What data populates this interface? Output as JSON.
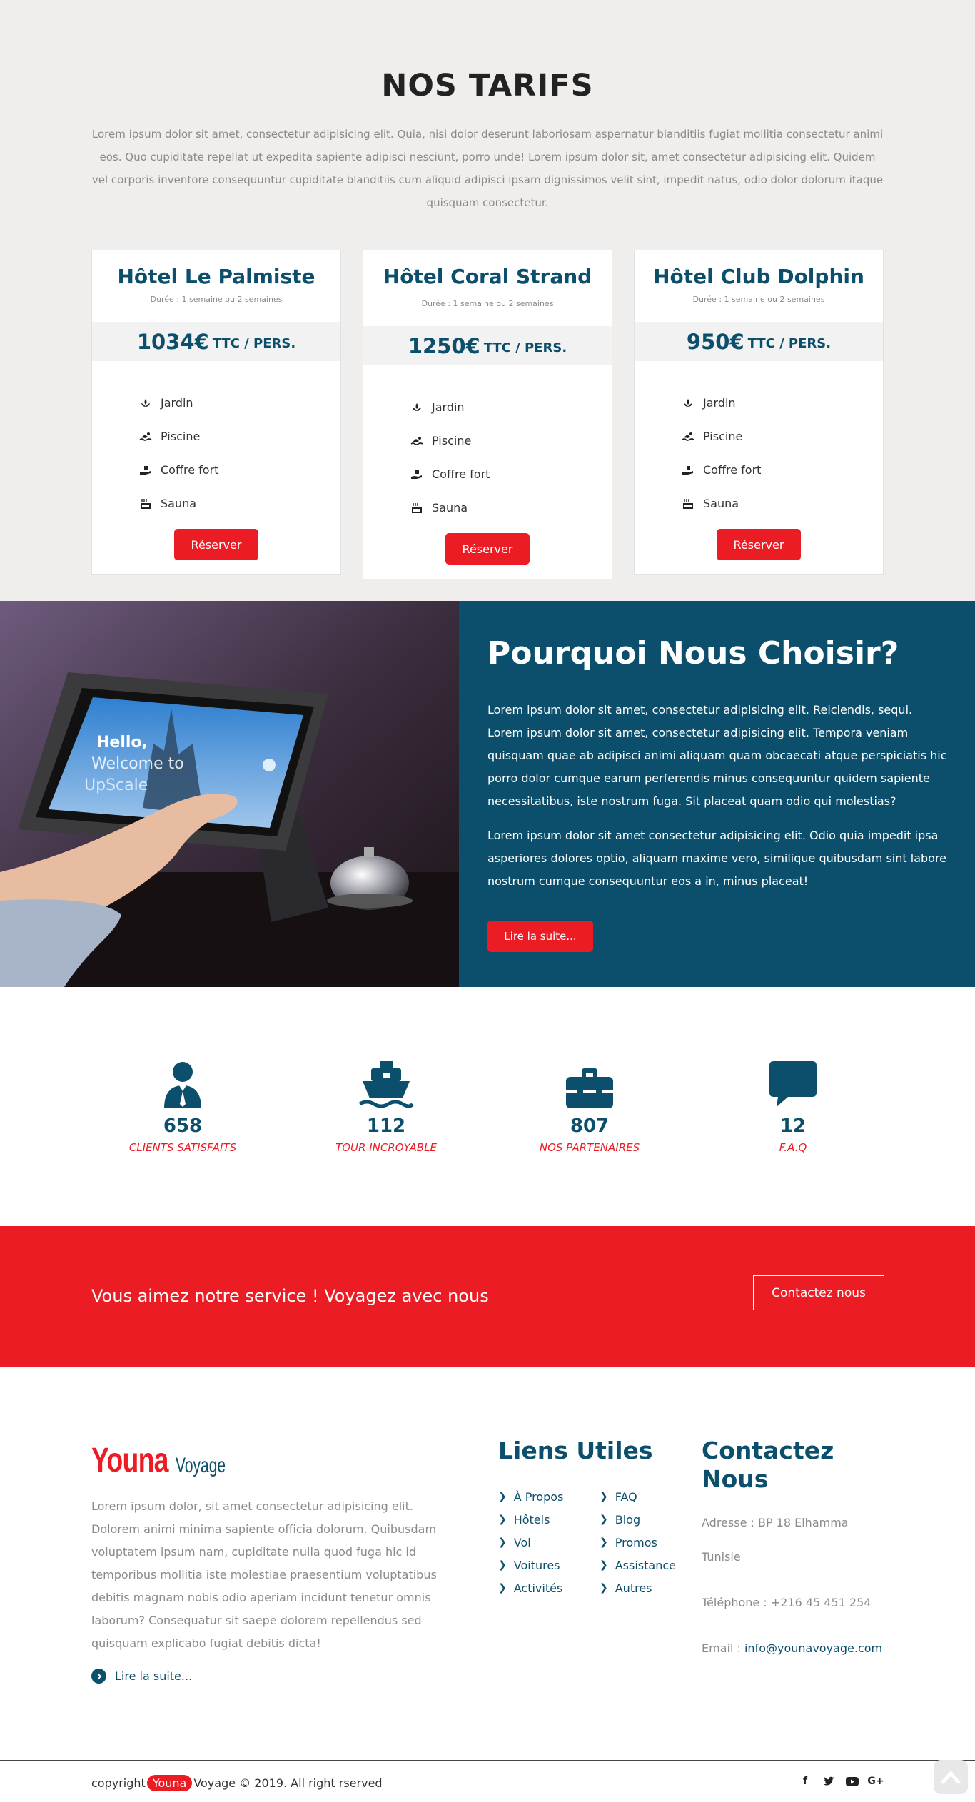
{
  "pricing": {
    "title": "NOS TARIFS",
    "intro": "Lorem ipsum dolor sit amet, consectetur adipisicing elit. Quia, nisi dolor deserunt laboriosam aspernatur blanditiis fugiat mollitia consectetur animi eos. Quo cupiditate repellat ut expedita sapiente adipisci nesciunt, porro unde! Lorem ipsum dolor sit, amet consectetur adipisicing elit. Quidem vel corporis inventore consequuntur cupiditate blanditiis cum aliquid adipisci ipsam dignissimos velit sint, impedit natus, odio dolor dolorum itaque quisquam consectetur.",
    "cards": [
      {
        "name": "Hôtel Le Palmiste",
        "duration": "Durée : 1 semaine ou 2 semaines",
        "price": "1034€",
        "unit": "TTC / PERS.",
        "features": [
          {
            "label": "Jardin",
            "icon": "spa-icon"
          },
          {
            "label": "Piscine",
            "icon": "swimmer-icon"
          },
          {
            "label": "Coffre fort",
            "icon": "hand-holding-icon"
          },
          {
            "label": "Sauna",
            "icon": "hot-tub-icon"
          }
        ],
        "button": "Réserver"
      },
      {
        "name": "Hôtel Coral Strand",
        "duration": "Durée : 1 semaine ou 2 semaines",
        "price": "1250€",
        "unit": "TTC / PERS.",
        "features": [
          {
            "label": "Jardin",
            "icon": "spa-icon"
          },
          {
            "label": "Piscine",
            "icon": "swimmer-icon"
          },
          {
            "label": "Coffre fort",
            "icon": "hand-holding-icon"
          },
          {
            "label": "Sauna",
            "icon": "hot-tub-icon"
          }
        ],
        "button": "Réserver"
      },
      {
        "name": "Hôtel Club Dolphin",
        "duration": "Durée : 1 semaine ou 2 semaines",
        "price": "950€",
        "unit": "TTC / PERS.",
        "features": [
          {
            "label": "Jardin",
            "icon": "spa-icon"
          },
          {
            "label": "Piscine",
            "icon": "swimmer-icon"
          },
          {
            "label": "Coffre fort",
            "icon": "hand-holding-icon"
          },
          {
            "label": "Sauna",
            "icon": "hot-tub-icon"
          }
        ],
        "button": "Réserver"
      }
    ]
  },
  "why": {
    "title": "Pourquoi Nous Choisir?",
    "paragraph1": "Lorem ipsum dolor sit amet, consectetur adipisicing elit. Reiciendis, sequi. Lorem ipsum dolor sit amet, consectetur adipisicing elit. Tempora veniam quisquam quae ab adipisci animi aliquam quam obcaecati atque perspiciatis hic porro dolor cumque earum perferendis minus consequuntur quidem sapiente necessitatibus, iste nostrum fuga. Sit placeat quam odio qui molestias?",
    "paragraph2": "Lorem ipsum dolor sit amet consectetur adipisicing elit. Odio quia impedit ipsa asperiores dolores optio, aliquam maxime vero, similique quibusdam sint labore nostrum cumque consequuntur eos a in, minus placeat!",
    "button": "Lire la suite...",
    "tablet_screen": {
      "line1": "Hello,",
      "line2": "Welcome to",
      "line3": "UpScale"
    }
  },
  "stats": [
    {
      "value": "658",
      "label": "CLIENTS SATISFAITS",
      "icon": "user-tie-icon"
    },
    {
      "value": "112",
      "label": "TOUR INCROYABLE",
      "icon": "ship-icon"
    },
    {
      "value": "807",
      "label": "NOS PARTENAIRES",
      "icon": "toolbox-icon"
    },
    {
      "value": "12",
      "label": "F.A.Q",
      "icon": "comment-icon"
    }
  ],
  "cta": {
    "text": "Vous aimez notre service ! Voyagez avec nous",
    "button": "Contactez nous"
  },
  "footer": {
    "logo_main": "Youna",
    "logo_sub": "Voyage",
    "about": "Lorem ipsum dolor, sit amet consectetur adipisicing elit. Dolorem animi minima sapiente officia dolorum. Quibusdam voluptatem ipsum nam, cupiditate nulla quod fuga hic id temporibus mollitia iste molestiae praesentium voluptatibus debitis magnam nobis odio aperiam incidunt tenetur omnis laborum? Consequatur sit saepe dolorem repellendus sed quisquam explicabo fugiat debitis dicta!",
    "read_more": "Lire la suite...",
    "links_title": "Liens Utiles",
    "links_col1": [
      "À Propos",
      "Hôtels",
      "Vol",
      "Voitures",
      "Activités"
    ],
    "links_col2": [
      "FAQ",
      "Blog",
      "Promos",
      "Assistance",
      "Autres"
    ],
    "contact_title": "Contactez Nous",
    "address": "Adresse : BP 18 Elhamma",
    "country": "Tunisie",
    "phone": "Téléphone : +216 45 451 254",
    "email_label": "Email :",
    "email": "info@younavoyage.com",
    "copyright_prefix": "copyright",
    "copyright_brand": "Youna",
    "copyright_suffix": "Voyage © 2019. All right rserved",
    "social": [
      "facebook-icon",
      "twitter-icon",
      "youtube-icon",
      "google-plus-icon"
    ]
  },
  "colors": {
    "brand_red": "#ec1c24",
    "brand_blue": "#0b4f6c",
    "section_grey": "#efeeec"
  }
}
